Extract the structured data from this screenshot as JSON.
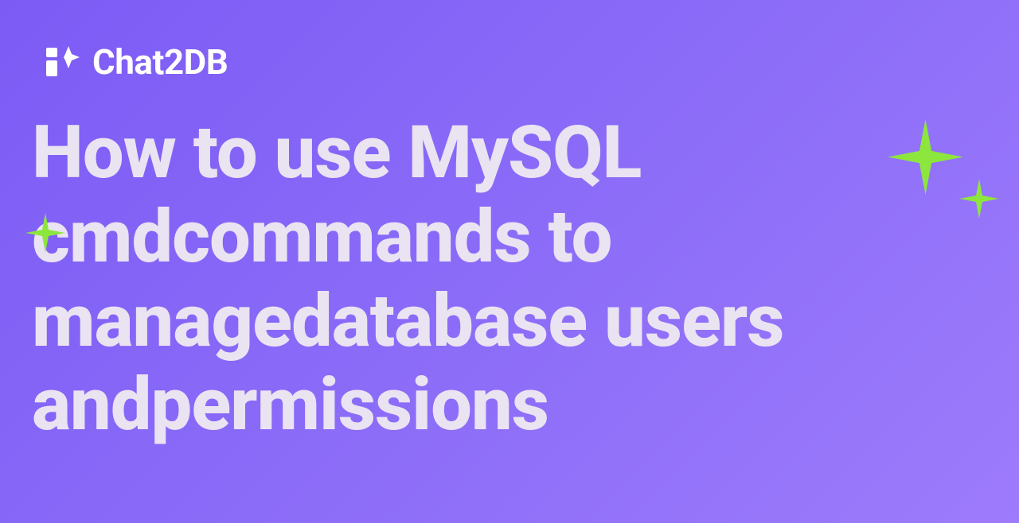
{
  "brand": {
    "name": "Chat2DB"
  },
  "headline": "How to use MySQL cmdcommands to managedatabase users andpermissions"
}
